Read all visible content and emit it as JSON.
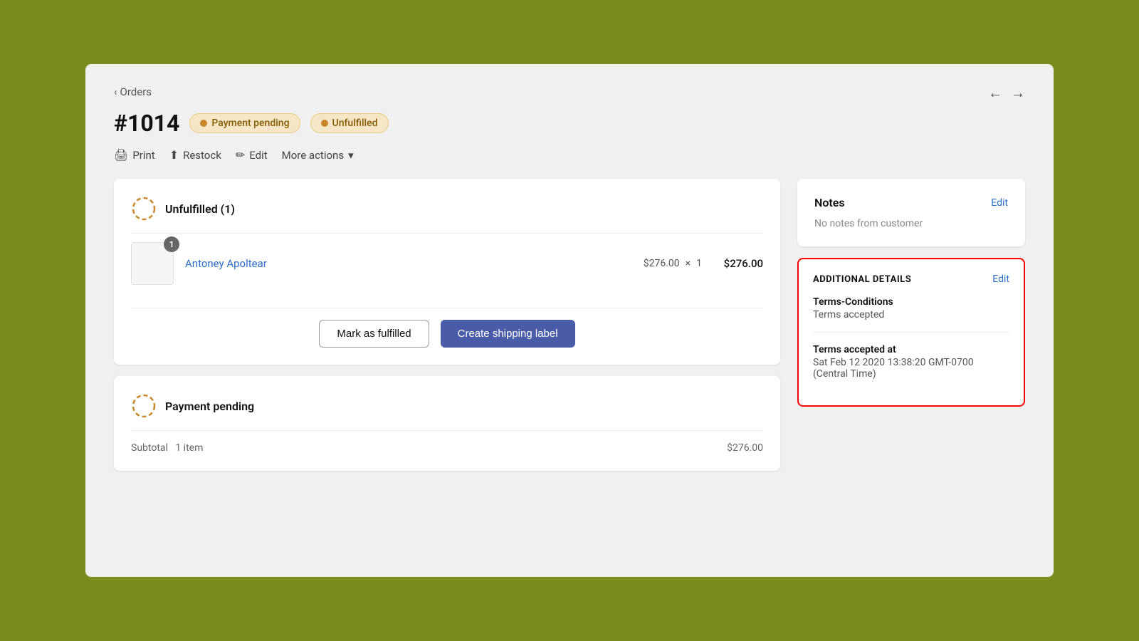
{
  "nav": {
    "back_label": "Orders",
    "back_arrow": "‹",
    "prev_arrow": "←",
    "next_arrow": "→"
  },
  "order": {
    "number": "#1014",
    "badges": [
      {
        "label": "Payment pending",
        "type": "payment"
      },
      {
        "label": "Unfulfilled",
        "type": "unfulfilled"
      }
    ]
  },
  "toolbar": {
    "print_label": "Print",
    "restock_label": "Restock",
    "edit_label": "Edit",
    "more_actions_label": "More actions"
  },
  "unfulfilled_section": {
    "title": "Unfulfilled (1)",
    "product": {
      "name": "Antoney Apoltear",
      "price": "$276.00",
      "quantity": 1,
      "qty_badge": "1",
      "multiplier": "×",
      "total": "$276.00"
    },
    "actions": {
      "mark_fulfilled": "Mark as fulfilled",
      "create_label": "Create shipping label"
    }
  },
  "payment_section": {
    "title": "Payment pending",
    "subtotal_label": "Subtotal",
    "subtotal_items": "1 item",
    "subtotal_value": "$276.00"
  },
  "notes": {
    "title": "Notes",
    "edit_label": "Edit",
    "content": "No notes from customer"
  },
  "additional_details": {
    "title": "ADDITIONAL DETAILS",
    "edit_label": "Edit",
    "fields": [
      {
        "label": "Terms-Conditions",
        "value": "Terms accepted"
      },
      {
        "label": "Terms accepted at",
        "value": "Sat Feb 12 2020 13:38:20 GMT-0700 (Central Time)"
      }
    ]
  }
}
